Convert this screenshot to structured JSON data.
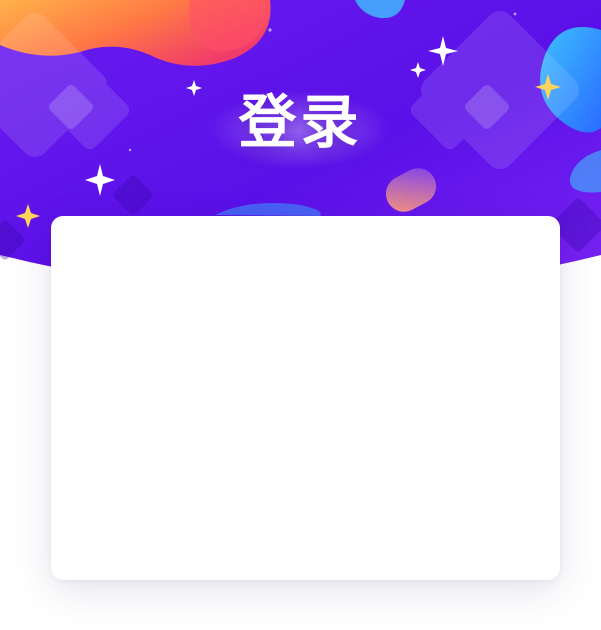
{
  "page": {
    "title": "登录"
  },
  "theme": {
    "primary_purple": "#5a10e8",
    "deep_purple": "#4a0bd0",
    "blob_orange": "#ff8a3d",
    "blob_red": "#f24a5b",
    "blob_blue": "#2fa8ff",
    "sparkle_white": "#ffffff",
    "sparkle_gold": "#ffd45a",
    "card_background": "#ffffff"
  },
  "decorations": {
    "icons": [
      "sparkle-icon",
      "diamond-shape",
      "blob-shape"
    ]
  },
  "login_card": {
    "state": "empty"
  }
}
